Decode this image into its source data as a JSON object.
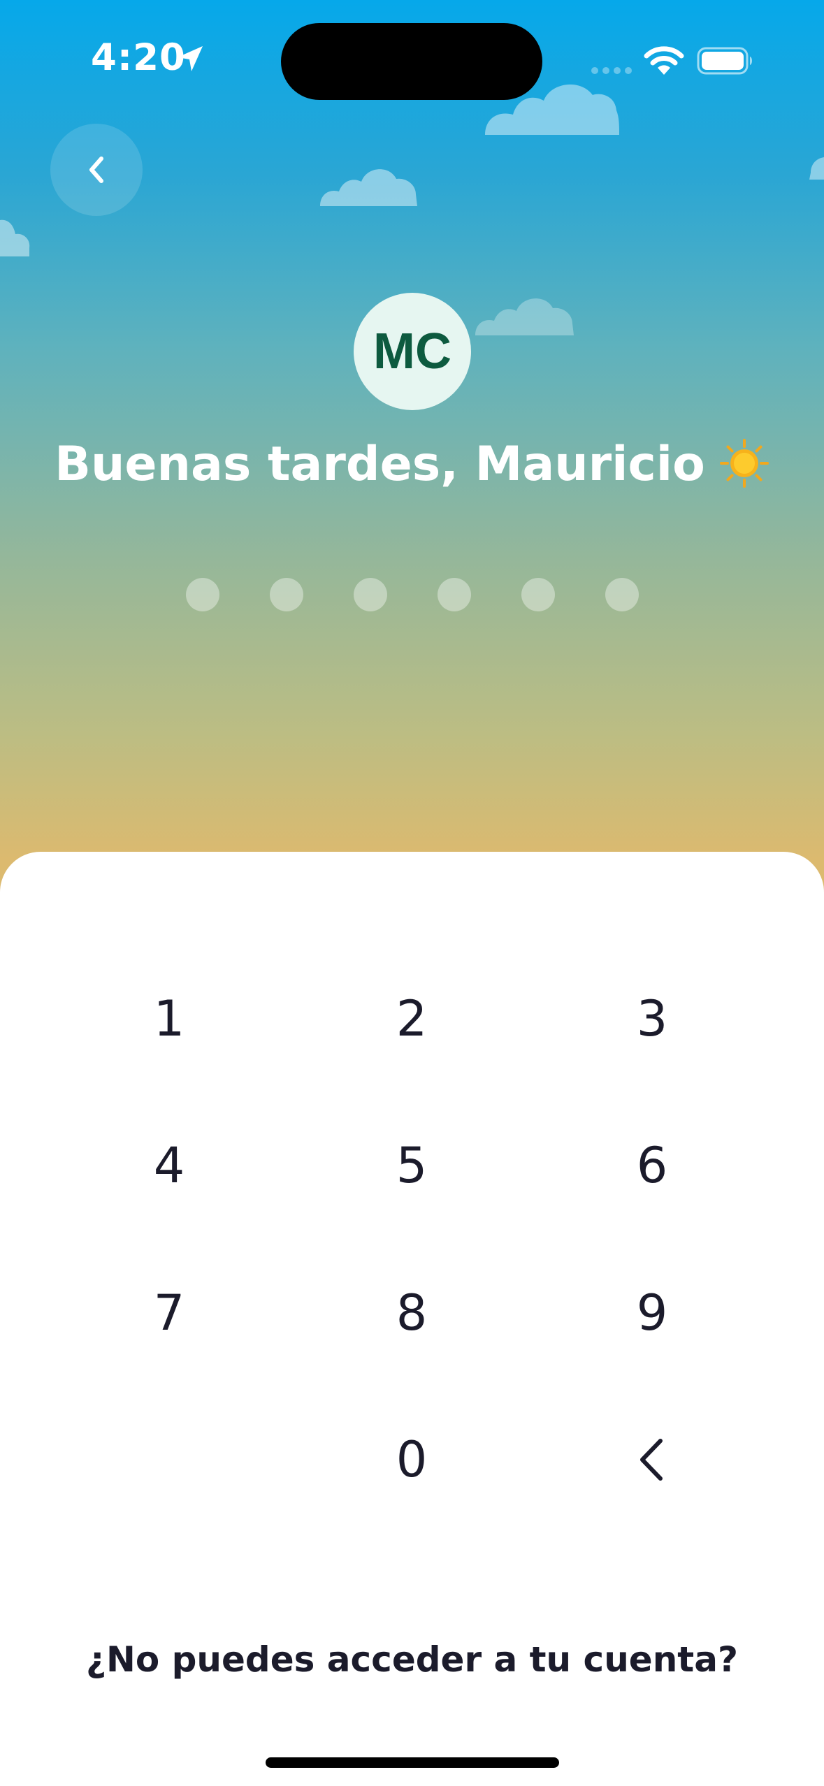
{
  "status_bar": {
    "time": "4:20"
  },
  "icons": {
    "location": "location-arrow-icon",
    "signal": "cellular-signal-icon",
    "wifi": "wifi-icon",
    "battery": "battery-icon",
    "back": "chevron-left-icon",
    "sun": "sun-icon",
    "backspace": "chevron-left-icon"
  },
  "profile": {
    "initials": "MC",
    "greeting": "Buenas tardes, Mauricio"
  },
  "pin": {
    "length": 6,
    "entered": 0
  },
  "keypad": {
    "keys": [
      "1",
      "2",
      "3",
      "4",
      "5",
      "6",
      "7",
      "8",
      "9",
      "0"
    ]
  },
  "help": {
    "link_label": "¿No puedes acceder a tu cuenta?"
  },
  "colors": {
    "sky_top": "#06a8ea",
    "sky_bottom": "#dcba6f",
    "avatar_bg": "#e6f6f1",
    "avatar_text": "#0d5a3f",
    "key_text": "#1b1b2b"
  }
}
